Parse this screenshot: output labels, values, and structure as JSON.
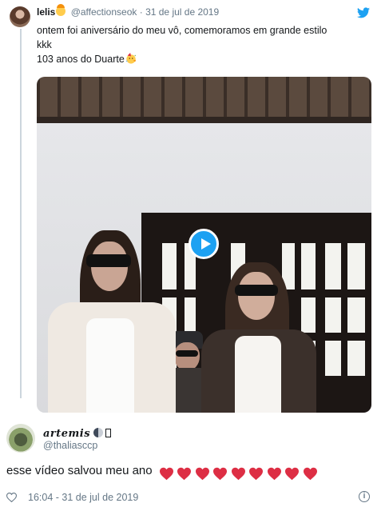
{
  "tweet": {
    "author_name": "lelis",
    "author_handle": "@affectionseok",
    "separator": "·",
    "date": "31 de jul de 2019",
    "text_line1": "ontem foi aniversário do meu vô, comemoramos em grande estilo",
    "text_line2": "kkk",
    "text_line3": "103 anos do Duarte",
    "icons": [
      "avatar",
      "crown-face-emoji",
      "twitter-bird-icon",
      "party-face-emoji",
      "play-icon"
    ],
    "accent_color": "#1da1f2"
  },
  "reply": {
    "author_name": "artemis",
    "author_handle": "@thaliasccp",
    "text": "esse vídeo salvou meu ano",
    "heart_count": 9,
    "heart_color": "#dd2e44",
    "time": "16:04",
    "separator": " - ",
    "date": "31 de jul de 2019",
    "icons": [
      "avatar",
      "moon-emoji",
      "heart-outline-icon",
      "info-icon"
    ]
  },
  "colors": {
    "text": "#14171a",
    "muted": "#657786",
    "thread_line": "#ccd6dd"
  }
}
